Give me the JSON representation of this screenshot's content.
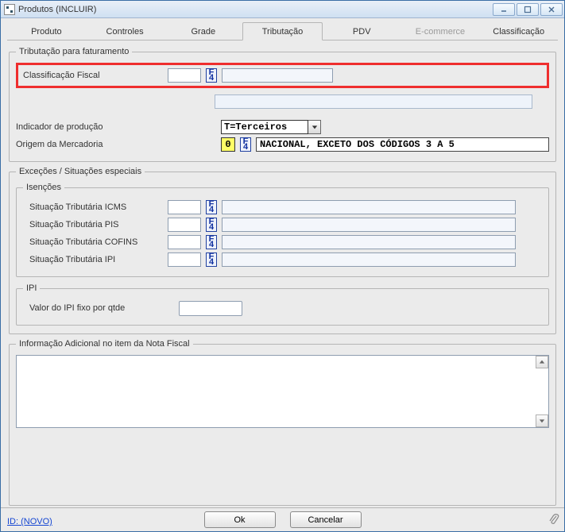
{
  "window": {
    "title": "Produtos (INCLUIR)"
  },
  "tabs": {
    "produto": "Produto",
    "controles": "Controles",
    "grade": "Grade",
    "tributacao": "Tributação",
    "pdv": "PDV",
    "ecommerce": "E-commerce",
    "classificacao": "Classificação"
  },
  "tribFatur": {
    "legend": "Tributação para faturamento",
    "classifFiscalLabel": "Classificação Fiscal",
    "classifFiscalCode": "",
    "classifFiscalDesc": "",
    "indicadorProducaoLabel": "Indicador de produção",
    "indicadorProducaoValue": "T=Terceiros",
    "origemLabel": "Origem da Mercadoria",
    "origemCode": "0",
    "origemDesc": "NACIONAL, EXCETO DOS CÓDIGOS 3 A 5"
  },
  "excecoes": {
    "legend": "Exceções / Situações especiais",
    "isencoesLegend": "Isenções",
    "icmsLabel": "Situação Tributária ICMS",
    "icmsCode": "",
    "icmsDesc": "",
    "pisLabel": "Situação Tributária PIS",
    "pisCode": "",
    "pisDesc": "",
    "cofinsLabel": "Situação Tributária COFINS",
    "cofinsCode": "",
    "cofinsDesc": "",
    "ipiLabel": "Situação Tributária IPI",
    "ipiCode": "",
    "ipiDesc": "",
    "ipiSectionLegend": "IPI",
    "valorIpiLabel": "Valor do IPI fixo por qtde",
    "valorIpiValue": ""
  },
  "infoAdicional": {
    "legend": "Informação Adicional no item da Nota Fiscal"
  },
  "footer": {
    "ok": "Ok",
    "cancel": "Cancelar",
    "idLink": "ID: (NOVO)"
  },
  "lookupHint": "F4"
}
